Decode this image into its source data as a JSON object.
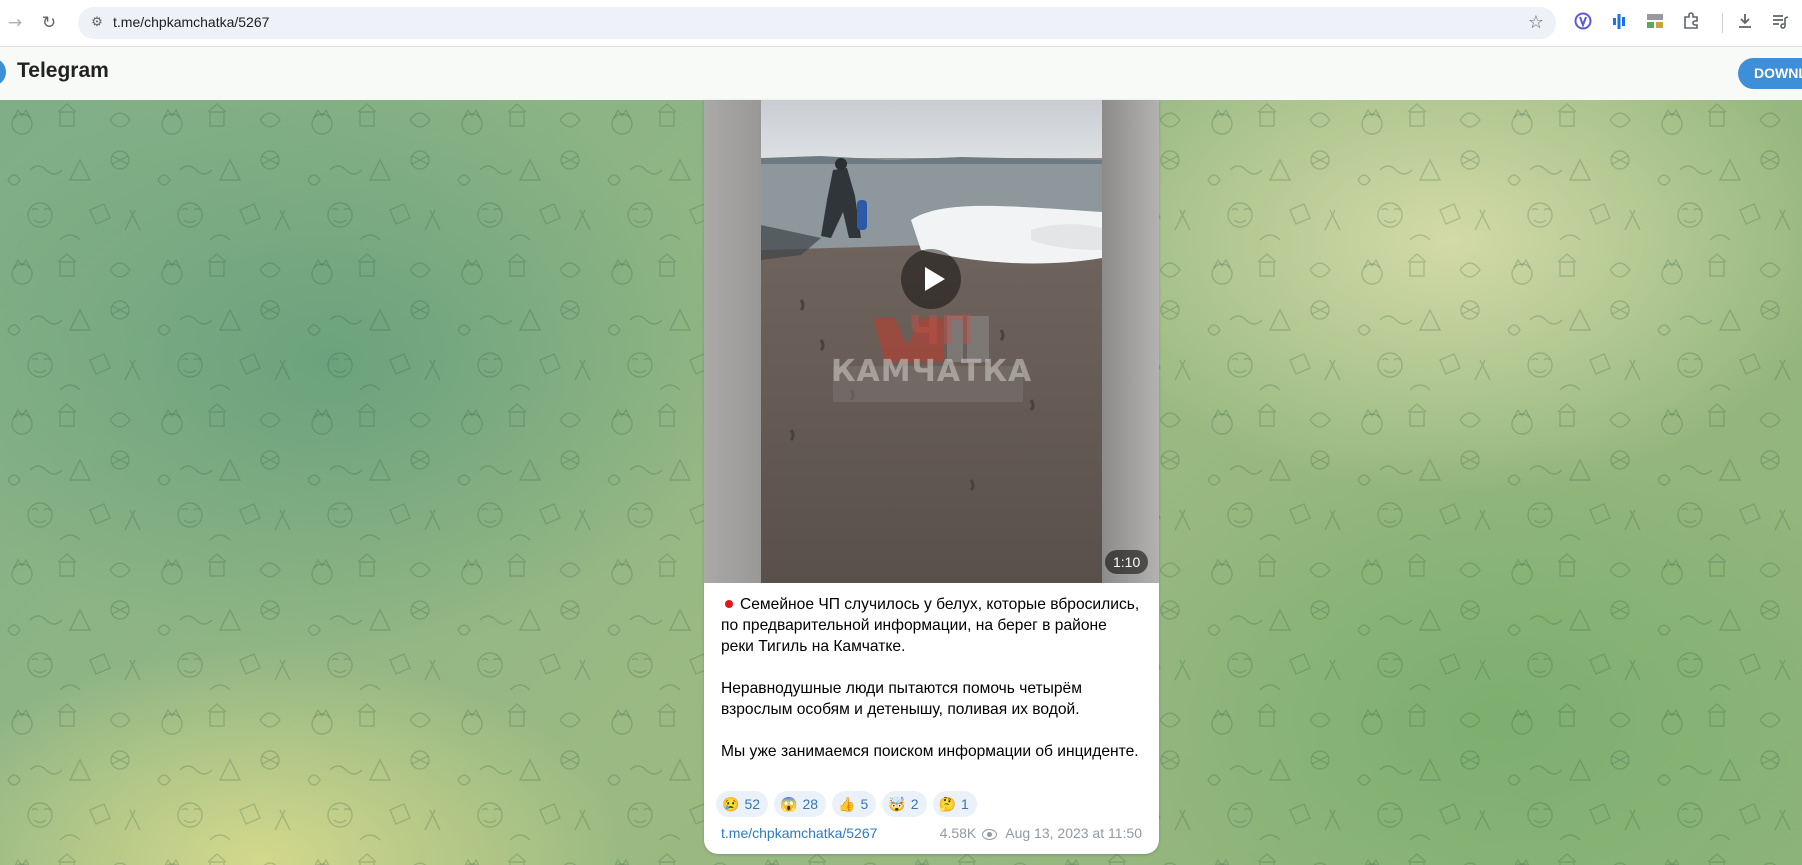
{
  "browser": {
    "url": "t.me/chpkamchatka/5267",
    "extension_icons": [
      "vpn-icon",
      "audio-bars-icon",
      "mode-badge-icon",
      "extensions-puzzle-icon"
    ]
  },
  "header": {
    "app_name": "Telegram",
    "download_label": "DOWNLOAD",
    "accent_color": "#3d8fd8"
  },
  "post": {
    "video": {
      "duration": "1:10",
      "watermark_line1": "ЧП",
      "watermark_line2": "КАМЧАТКА"
    },
    "paragraphs": [
      "Семейное ЧП случилось у белух, которые вбросились, по предварительной информации, на берег в районе реки Тигиль на Камчатке.",
      "Неравнодушные люди пытаются помочь четырём взрослым особям и детенышу, поливая их водой.",
      "Мы уже занимаемся поиском информации об инциденте."
    ],
    "reactions": [
      {
        "emoji": "😢",
        "count": "52"
      },
      {
        "emoji": "😱",
        "count": "28"
      },
      {
        "emoji": "👍",
        "count": "5"
      },
      {
        "emoji": "🤯",
        "count": "2"
      },
      {
        "emoji": "🤔",
        "count": "1"
      }
    ],
    "link": "t.me/chpkamchatka/5267",
    "views": "4.58K",
    "date": "Aug 13, 2023 at 11:50"
  }
}
